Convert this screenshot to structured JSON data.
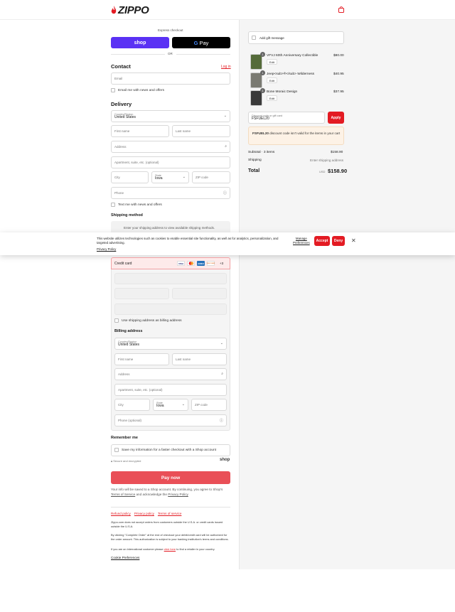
{
  "header": {
    "logo_text": "ZIPPO",
    "cart_icon": "bag-icon"
  },
  "express": {
    "label": "Express checkout",
    "shop_label": "shop",
    "gpay_label": "Pay",
    "or_label": "OR"
  },
  "contact": {
    "title": "Contact",
    "login_label": "Log in",
    "email_placeholder": "Email",
    "news_label": "Email me with news and offers"
  },
  "delivery": {
    "title": "Delivery",
    "country_label": "Country/Region",
    "country_value": "United States",
    "first_name": "First name",
    "last_name": "Last name",
    "address": "Address",
    "apartment": "Apartment, suite, etc. (optional)",
    "city": "City",
    "state_label": "State",
    "state_value": "Iowa",
    "zip": "ZIP code",
    "phone": "Phone",
    "text_news": "Text me with news and offers"
  },
  "shipping": {
    "title": "Shipping method",
    "message": "Enter your shipping address to view available shipping methods."
  },
  "cookie": {
    "text": "This website utilizes technologies such as cookies to enable essential site functionality, as well as for analytics, personalization, and targeted advertising.",
    "privacy": "Privacy Policy",
    "manage_line1": "Manage",
    "manage_line2": "Preferences",
    "accept": "Accept",
    "deny": "Deny"
  },
  "payment": {
    "credit_card": "Credit card",
    "more_cards": "+3",
    "cards": [
      "VISA",
      "MC",
      "AMEX",
      "DISCOVER"
    ],
    "use_shipping": "Use shipping address as billing address"
  },
  "billing": {
    "title": "Billing address",
    "country_label": "Country/Region",
    "country_value": "United States",
    "first_name": "First name",
    "last_name": "Last name",
    "address": "Address",
    "apartment": "Apartment, suite, etc. (optional)",
    "city": "City",
    "state_label": "State",
    "state_value": "Iowa",
    "zip": "ZIP code",
    "phone": "Phone (optional)"
  },
  "remember": {
    "title": "Remember me",
    "save_label": "Save my information for a faster checkout with a Shop account",
    "secure": "Secure and encrypted",
    "shop": "shop"
  },
  "pay_now": "Pay now",
  "legal": {
    "line1": "Your info will be saved to a Shop account. By continuing, you agree to Shop's",
    "tos": "Terms of Service",
    "and_ack": "and acknowledge the",
    "privacy": "Privacy Policy",
    "links": [
      "Refund policy",
      "Privacy policy",
      "Terms of service"
    ],
    "p1": "Zippo.com does not accept orders from customers outside the U.S.A. or credit cards issued outside the U.S.A.",
    "p2": "By clicking \"Complete Order\" at the end of checkout your debit/credit card will be authorized for the order amount. This authorization is subject to your banking institution's terms and conditions.",
    "p3a": "If you are an international customer please",
    "p3link": "click here",
    "p3b": "to find a retailer in your country.",
    "cookie_prefs": "Cookie Preferences"
  },
  "summary": {
    "gift": "Add gift message",
    "items": [
      {
        "qty": "1",
        "name": "VFVJ 60th Anniversary Collectible",
        "price": "$80.00",
        "edit": "Edit",
        "color": "#556b3a"
      },
      {
        "qty": "1",
        "name": "Jeep<sub>®</sub> Wilderness",
        "price": "$40.95",
        "edit": "Edit",
        "color": "#7a7a72"
      },
      {
        "qty": "1",
        "name": "Bone Moraic Design",
        "price": "$37.95",
        "edit": "Edit",
        "color": "#3a3a3a"
      }
    ],
    "discount_label": "Discount code or gift card",
    "discount_value": "FSFUEL20",
    "apply": "Apply",
    "error_code": "FSFUEL20",
    "error_text": "discount code isn't valid for the items in your cart",
    "subtotal_label": "Subtotal · 3 items",
    "subtotal": "$158.90",
    "shipping_label": "Shipping",
    "shipping_value": "Enter shipping address",
    "total_label": "Total",
    "currency": "USD",
    "total": "$158.90"
  }
}
